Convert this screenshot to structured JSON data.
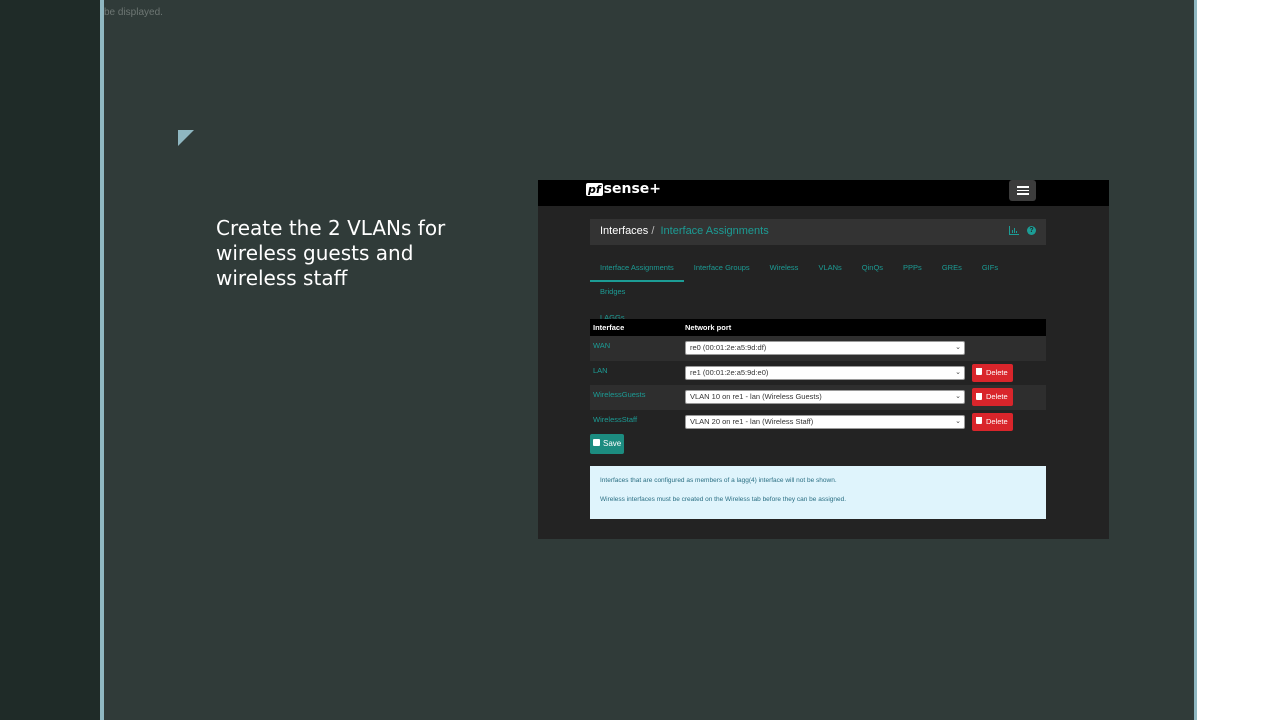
{
  "slide": {
    "alt_text": "be displayed.",
    "text": "Create the 2 VLANs for wireless guests and wireless staff"
  },
  "pfsense": {
    "logo": {
      "prefix": "pf",
      "name": "sense+"
    },
    "breadcrumb": {
      "root": "Interfaces",
      "separator": "/",
      "current": "Interface Assignments"
    },
    "tabs": [
      {
        "label": "Interface Assignments",
        "active": true
      },
      {
        "label": "Interface Groups"
      },
      {
        "label": "Wireless"
      },
      {
        "label": "VLANs"
      },
      {
        "label": "QinQs"
      },
      {
        "label": "PPPs"
      },
      {
        "label": "GREs"
      },
      {
        "label": "GIFs"
      },
      {
        "label": "Bridges"
      },
      {
        "label": "LAGGs"
      }
    ],
    "table": {
      "headers": [
        "Interface",
        "Network port"
      ],
      "rows": [
        {
          "interface": "WAN",
          "port": "re0 (00:01:2e:a5:9d:df)",
          "delete": ""
        },
        {
          "interface": "LAN",
          "port": "re1 (00:01:2e:a5:9d:e0)",
          "delete": "Delete"
        },
        {
          "interface": "WirelessGuests",
          "port": "VLAN 10 on re1 - lan (Wireless Guests)",
          "delete": "Delete"
        },
        {
          "interface": "WirelessStaff",
          "port": "VLAN 20 on re1 - lan (Wireless Staff)",
          "delete": "Delete"
        }
      ]
    },
    "save_label": "Save",
    "info": [
      "Interfaces that are configured as members of a lagg(4) interface will not be shown.",
      "Wireless interfaces must be created on the Wireless tab before they can be assigned."
    ],
    "colors": {
      "accent": "#1c9c95",
      "danger": "#d9252b",
      "info_bg": "#dff4fc"
    }
  }
}
